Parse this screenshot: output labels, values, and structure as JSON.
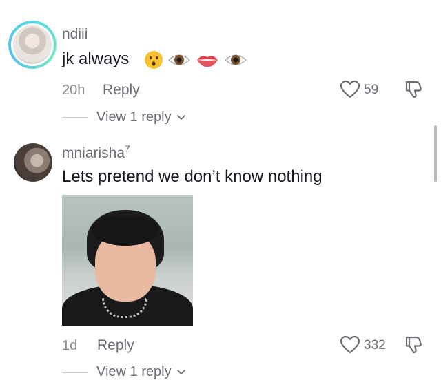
{
  "comments": [
    {
      "username": "ndiii",
      "text": "jk always",
      "emojis": [
        "hushed-face",
        "eye",
        "lips",
        "eye"
      ],
      "time": "20h",
      "reply_label": "Reply",
      "like_count": "59",
      "view_replies": "View 1 reply"
    },
    {
      "username": "mniarisha",
      "username_suffix": "7",
      "text": "Lets pretend we don’t know nothing",
      "time": "1d",
      "reply_label": "Reply",
      "like_count": "332",
      "view_replies": "View 1 reply"
    }
  ],
  "colors": {
    "text": "#161823",
    "muted": "#6b6d75",
    "story_ring": "#57d9e3"
  }
}
